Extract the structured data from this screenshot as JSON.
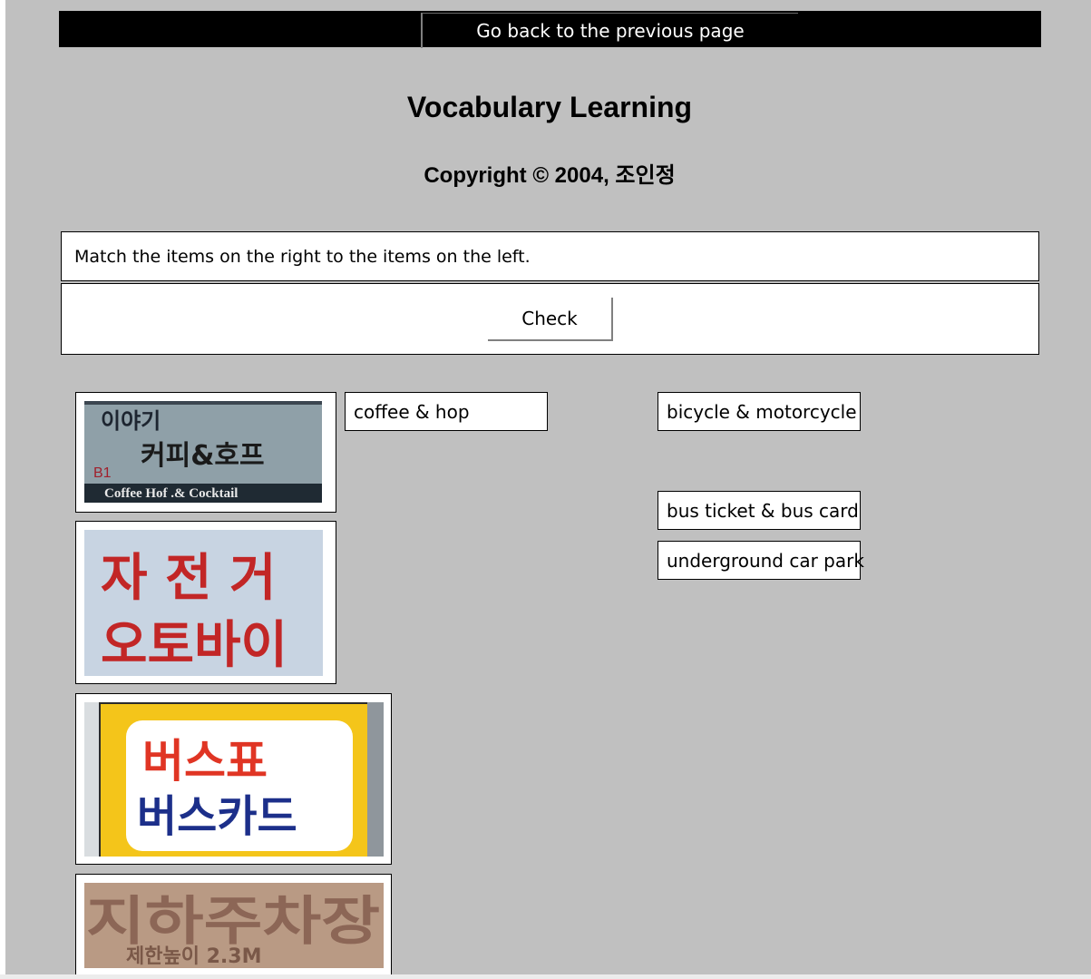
{
  "nav": {
    "back_label": "Go back to the previous page"
  },
  "header": {
    "title": "Vocabulary Learning",
    "copyright": "Copyright © 2004, 조인정"
  },
  "instructions": "Match the items on the right to the items on the left.",
  "check_label": "Check",
  "sign_images": [
    {
      "line1": "이야기",
      "line2": "커피&호프",
      "badge": "B1",
      "footer": "Coffee   Hof .& Cocktail"
    },
    {
      "line1": "자 전 거",
      "line2": "오토바이"
    },
    {
      "line1": "버스표",
      "line2": "버스카드"
    },
    {
      "line1": "지하주차장",
      "line2": "제한높이 2.3M"
    }
  ],
  "placed_answers": [
    "coffee & hop"
  ],
  "answer_choices": [
    "bicycle & motorcycle",
    "bus ticket & bus card",
    "underground car park"
  ],
  "colors": {
    "page_bg": "#c0c0c0",
    "sign1_bg": "#8fa0a8",
    "sign2_bg": "#c8d4e2",
    "sign2_text": "#c22626",
    "sign3_yellow": "#f4c51a",
    "sign3_red": "#e03524",
    "sign3_blue": "#1c2f8a",
    "sign4_bg": "#b99a84"
  }
}
